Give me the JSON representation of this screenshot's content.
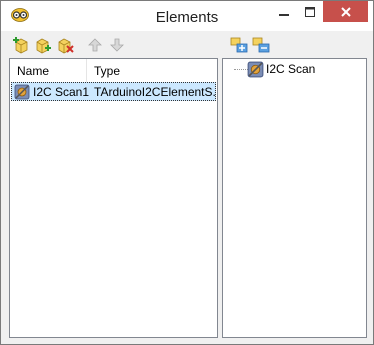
{
  "window": {
    "title": "Elements",
    "icon": "owl-glasses-icon"
  },
  "caption_buttons": [
    {
      "name": "minimize-button",
      "icon": "minimize-icon"
    },
    {
      "name": "maximize-button",
      "icon": "maximize-icon"
    },
    {
      "name": "close-button",
      "icon": "close-icon"
    }
  ],
  "toolbar": {
    "add_icon": "add-element-icon",
    "add_child_icon": "add-child-element-icon",
    "delete_icon": "delete-element-icon",
    "move_up_icon": "arrow-up-icon",
    "move_down_icon": "arrow-down-icon",
    "right_icon_1": "tree-expand-icon",
    "right_icon_2": "tree-collapse-icon"
  },
  "element_list": {
    "columns": [
      "Name",
      "Type"
    ],
    "rows": [
      {
        "name": "I2C Scan1",
        "type": "TArduinoI2CElementS...",
        "selected": true
      }
    ]
  },
  "tree": {
    "nodes": [
      {
        "label": "I2C Scan"
      }
    ]
  },
  "colors": {
    "selection": "#cce8ff",
    "close_button": "#c7504b",
    "window_bg": "#f0f0f0"
  }
}
